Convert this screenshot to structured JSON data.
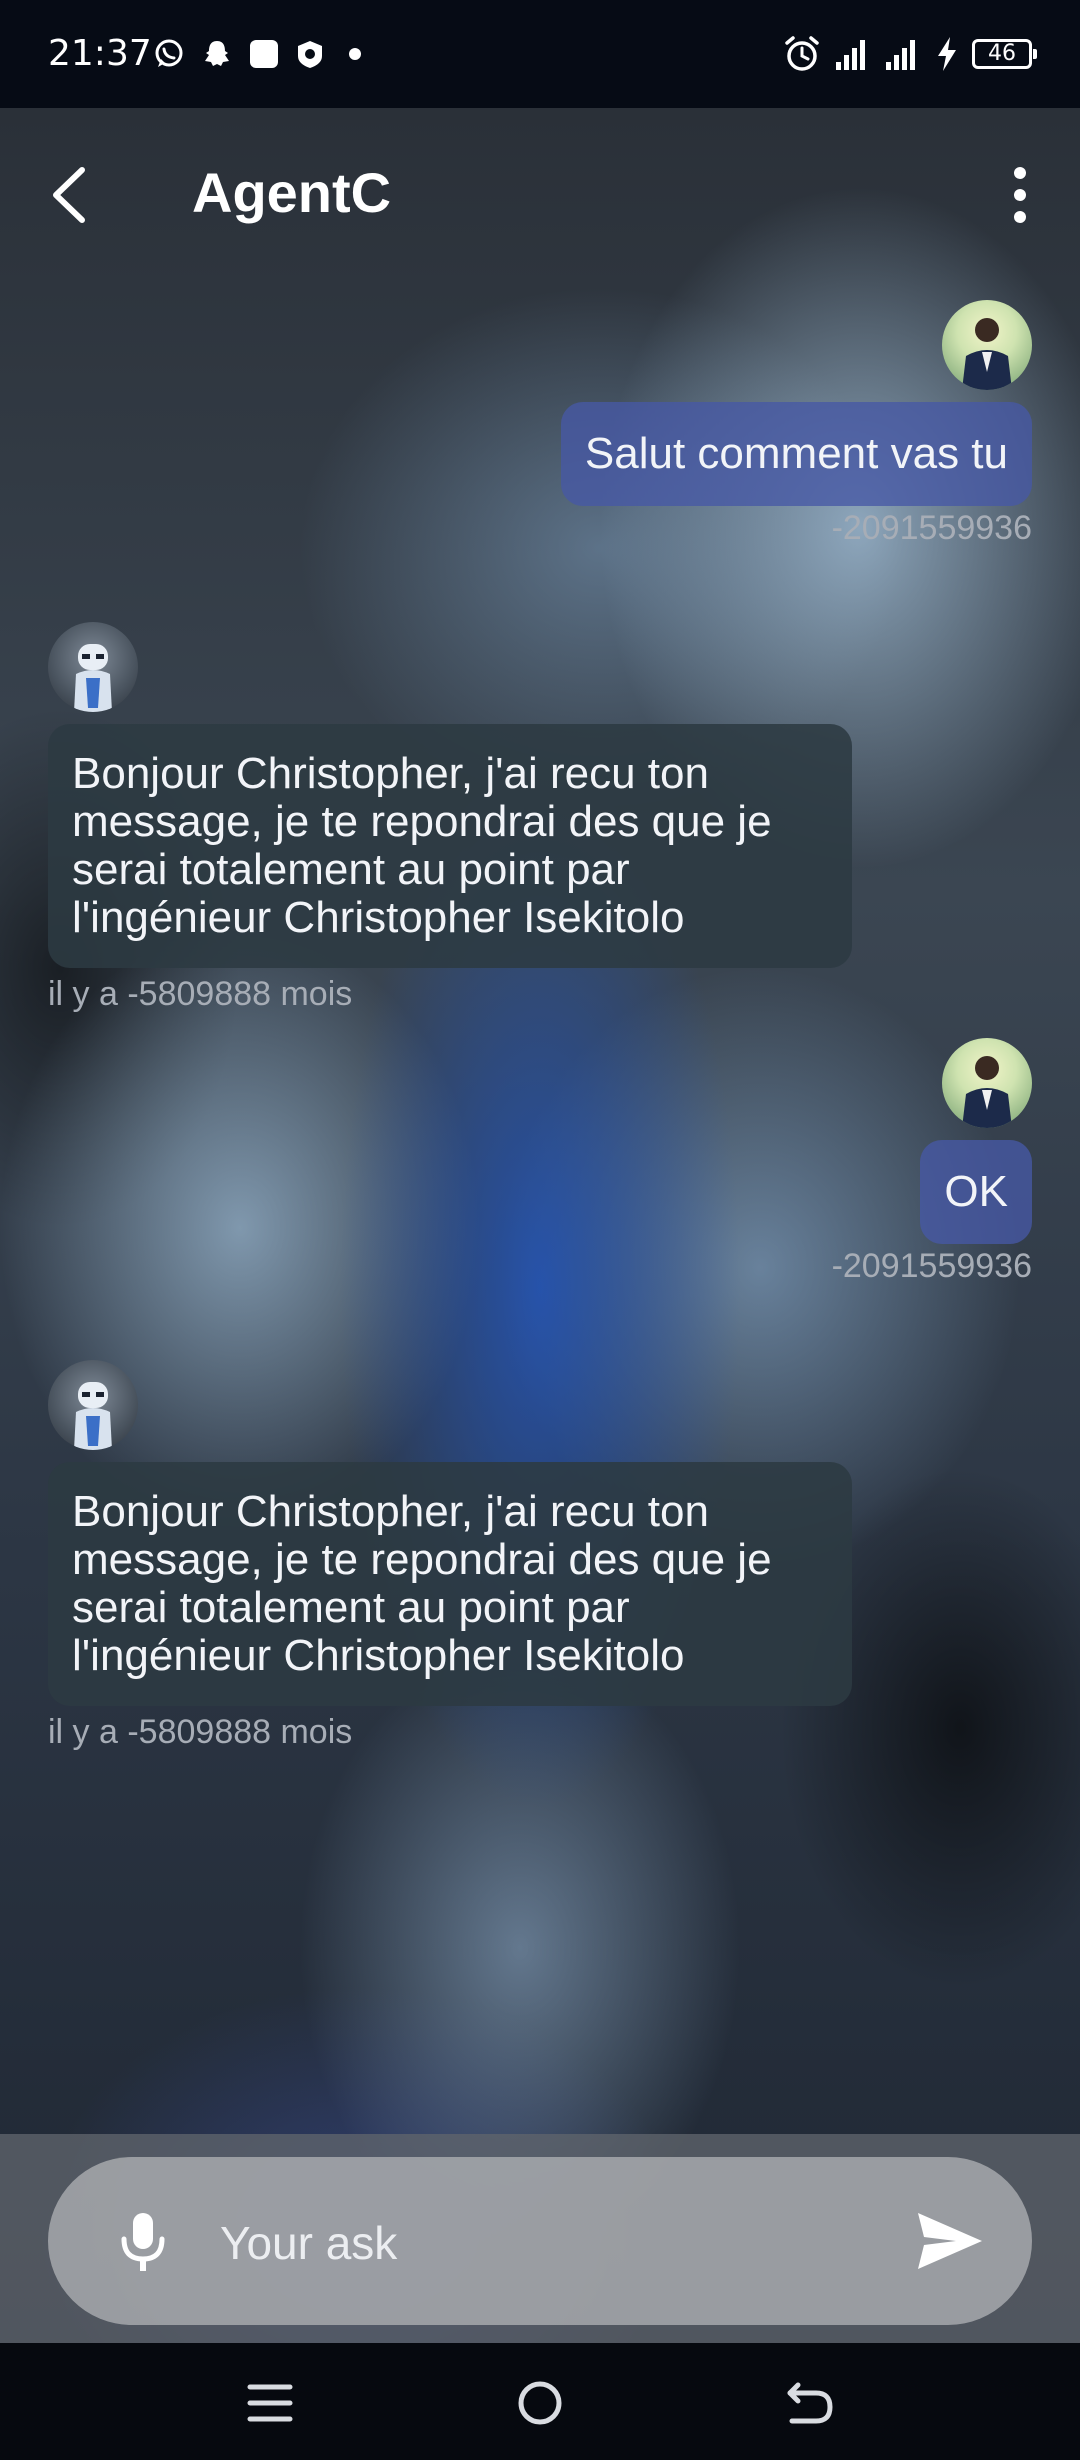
{
  "status_bar": {
    "time": "21:37",
    "left_icons": [
      "whatsapp-icon",
      "snapchat-icon",
      "square-app-icon",
      "shield-app-icon",
      "dot-icon"
    ],
    "right_icons": [
      "alarm-icon",
      "signal-icon",
      "signal-icon",
      "charging-icon"
    ],
    "battery": "46"
  },
  "header": {
    "title": "AgentC"
  },
  "messages": [
    {
      "sender": "user",
      "text": "Salut comment vas tu",
      "meta": "-2091559936"
    },
    {
      "sender": "bot",
      "text": "Bonjour Christopher, j'ai recu ton message, je te repondrai des que je serai totalement au point par l'ingénieur Christopher Isekitolo",
      "meta": "il y a -5809888 mois"
    },
    {
      "sender": "user",
      "text": "OK",
      "meta": "-2091559936"
    },
    {
      "sender": "bot",
      "text": "Bonjour Christopher, j'ai recu ton message, je te repondrai des que je serai totalement au point par l'ingénieur Christopher Isekitolo",
      "meta": "il y a -5809888 mois"
    }
  ],
  "composer": {
    "placeholder": "Your ask"
  },
  "colors": {
    "user_bubble": "#4658a5",
    "bot_bubble": "#2c3a42",
    "meta_text": "#a7adb6"
  }
}
